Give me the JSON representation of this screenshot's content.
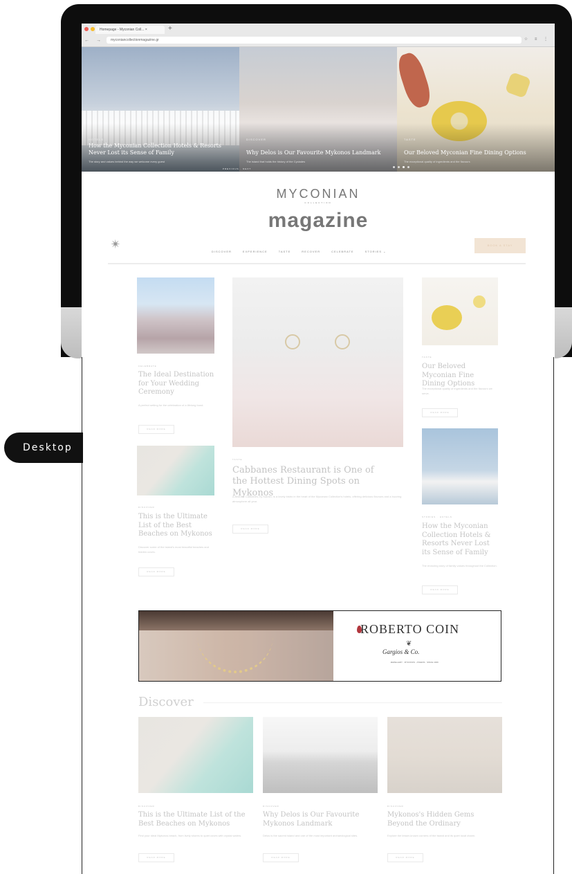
{
  "label": "Desktop",
  "browser": {
    "tab_title": "Homepage - Myconian Coll... ×",
    "new_tab": "+",
    "url": "myconiancollectionmagazine.gr",
    "nav_glyphs": "← → ↻",
    "tool_glyphs": "☆ ≡ ⋮"
  },
  "hero": {
    "slides": [
      {
        "category": "HOTELS",
        "title": "How the Myconian Collection Hotels & Resorts Never Lost its Sense of Family",
        "subtitle": "The story and values behind the way we welcome every guest"
      },
      {
        "category": "DISCOVER",
        "title": "Why Delos is Our Favourite Mykonos Landmark",
        "subtitle": "The island that holds the history of the Cyclades"
      },
      {
        "category": "TASTE",
        "title": "Our Beloved Myconian Fine Dining Options",
        "subtitle": "The exceptional quality of ingredients and the flavours"
      }
    ],
    "pager": "PREVIOUS  ·  NEXT"
  },
  "brand": {
    "line1": "MYCONIAN",
    "line2": "COLLECTION",
    "line3": "magazine"
  },
  "nav": {
    "items": [
      "DISCOVER",
      "EXPERIENCE",
      "TASTE",
      "RECOVER",
      "CELEBRATE",
      "STORIES ⌄"
    ],
    "cta": "BOOK A STAY"
  },
  "articles": {
    "wedding": {
      "category": "CELEBRATE",
      "title": "The Ideal Destination for Your Wedding Ceremony",
      "excerpt": "A perfect setting for the celebration of a lifelong bond.",
      "button": "READ MORE"
    },
    "beaches": {
      "category": "DISCOVER",
      "title": "This is the Ultimate List of the Best Beaches on Mykonos",
      "excerpt": "Discover some of the island's most beautiful beaches and hidden coves.",
      "button": "READ MORE"
    },
    "cabbanes": {
      "category": "TASTE",
      "title": "Cabbanes Restaurant is One of the Hottest Dining Spots on Mykonos",
      "excerpt": "A Bistro & Cabbanes, by Kalosh, is a lovely bistro in the heart of the Myconian Collection's hotels, offering delicious flavours and a buzzing atmosphere all year.",
      "button": "READ MORE"
    },
    "dining": {
      "category": "TASTE",
      "title": "Our Beloved Myconian Fine Dining Options",
      "excerpt": "The exceptional quality of ingredients and the flavours we serve.",
      "button": "READ MORE"
    },
    "family": {
      "category": "STORIES · HOTELS",
      "title": "How the Myconian Collection Hotels & Resorts Never Lost its Sense of Family",
      "excerpt": "The enduring story of family values throughout the Collection.",
      "button": "READ MORE"
    }
  },
  "ad": {
    "brand": "ROBERTO COIN",
    "seller": "Gargios & Co.",
    "mark": "❦",
    "fine_print": "JEWELLERY · MYKONOS · ATHENS · SINCE 1936"
  },
  "discover": {
    "title": "Discover",
    "cards": [
      {
        "category": "DISCOVER",
        "title": "This is the Ultimate List of the Best Beaches on Mykonos",
        "excerpt": "Find your ideal Mykonos beach, from lively shores to quiet coves with crystal waters.",
        "button": "READ MORE"
      },
      {
        "category": "DISCOVER",
        "title": "Why Delos is Our Favourite Mykonos Landmark",
        "excerpt": "Delos is the sacred island and one of the most important archaeological sites.",
        "button": "READ MORE"
      },
      {
        "category": "DISCOVER",
        "title": "Mykonos's Hidden Gems Beyond the Ordinary",
        "excerpt": "Explore the lesser-known corners of the island and its quiet local charm.",
        "button": "READ MORE"
      }
    ]
  },
  "colors": {
    "bezel": "#0d0d0d",
    "pill": "#111111",
    "cta_bg": "#f2e4d4",
    "gem": "#b2373e"
  }
}
